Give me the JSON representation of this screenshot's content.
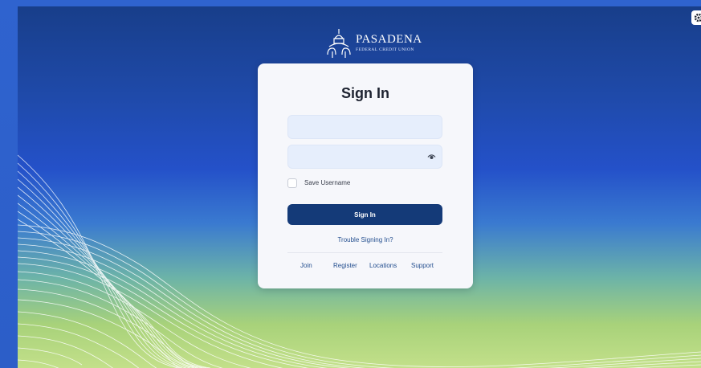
{
  "brand": {
    "name": "PASADENA",
    "subtitle": "FEDERAL CREDIT UNION"
  },
  "signin": {
    "title": "Sign In",
    "username_value": "",
    "password_value": "",
    "save_username_label": "Save Username",
    "save_username_checked": false,
    "button_label": "Sign In",
    "trouble_link": "Trouble Signing In?"
  },
  "footer_links": [
    "Join",
    "Register",
    "Locations",
    "Support"
  ],
  "icons": {
    "show_password": "eye-icon",
    "settings": "gear-icon",
    "logo": "city-hall-dome-icon"
  },
  "colors": {
    "primary_button": "#143a78",
    "link": "#244f8f",
    "card_background": "#f6f7fb",
    "input_background": "#e6eefc"
  }
}
